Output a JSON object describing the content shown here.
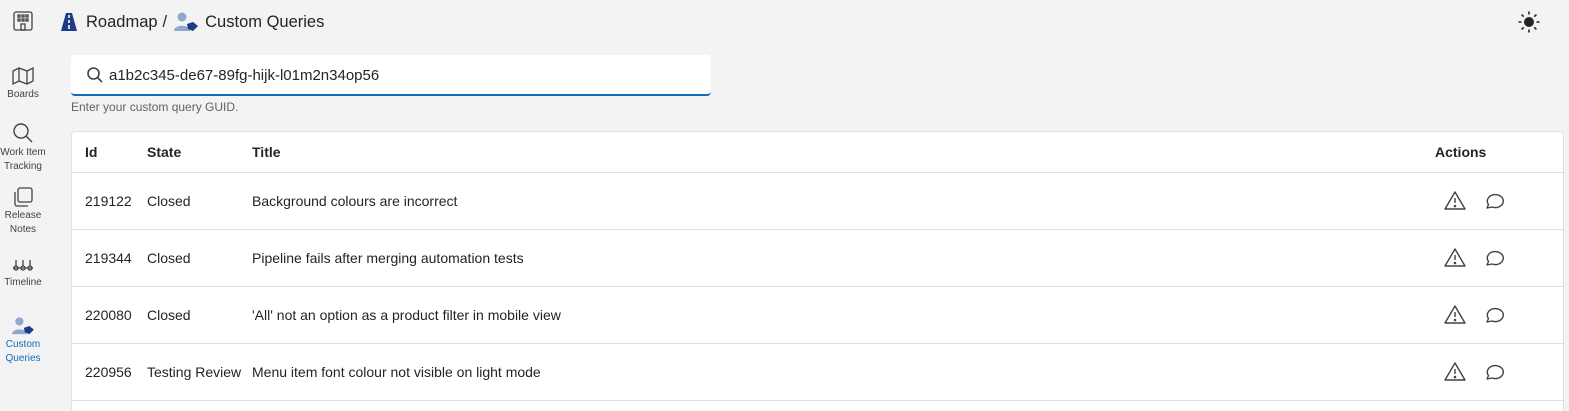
{
  "header": {
    "crumbs": [
      {
        "label": "Roadmap",
        "icon": "roadmap-icon"
      },
      {
        "label": "Custom Queries",
        "icon": "custom-queries-icon"
      }
    ],
    "separator": "/",
    "theme_icon": "sun-icon"
  },
  "sidebar": {
    "items": [
      {
        "label": "Boards",
        "icon": "map-icon",
        "active": false
      },
      {
        "label": "Work Item\nTracking",
        "icon": "search-icon",
        "active": false
      },
      {
        "label": "Release\nNotes",
        "icon": "notes-icon",
        "active": false
      },
      {
        "label": "Timeline",
        "icon": "timeline-icon",
        "active": false
      },
      {
        "label": "Custom\nQueries",
        "icon": "custom-queries-icon",
        "active": true
      }
    ]
  },
  "search": {
    "value": "a1b2c345-de67-89fg-hijk-l01m2n34op56",
    "hint": "Enter your custom query GUID."
  },
  "table": {
    "columns": [
      "Id",
      "State",
      "Title",
      "Actions"
    ],
    "rows": [
      {
        "id": "219122",
        "state": "Closed",
        "title": "Background colours are incorrect"
      },
      {
        "id": "219344",
        "state": "Closed",
        "title": "Pipeline fails after merging automation tests"
      },
      {
        "id": "220080",
        "state": "Closed",
        "title": "'All' not an option as a product filter in mobile view"
      },
      {
        "id": "220956",
        "state": "Testing Review",
        "title": "Menu item font colour not visible on light mode"
      }
    ]
  },
  "colors": {
    "accent": "#0f6cbd",
    "background": "#f3f3f3",
    "surface": "#ffffff"
  }
}
